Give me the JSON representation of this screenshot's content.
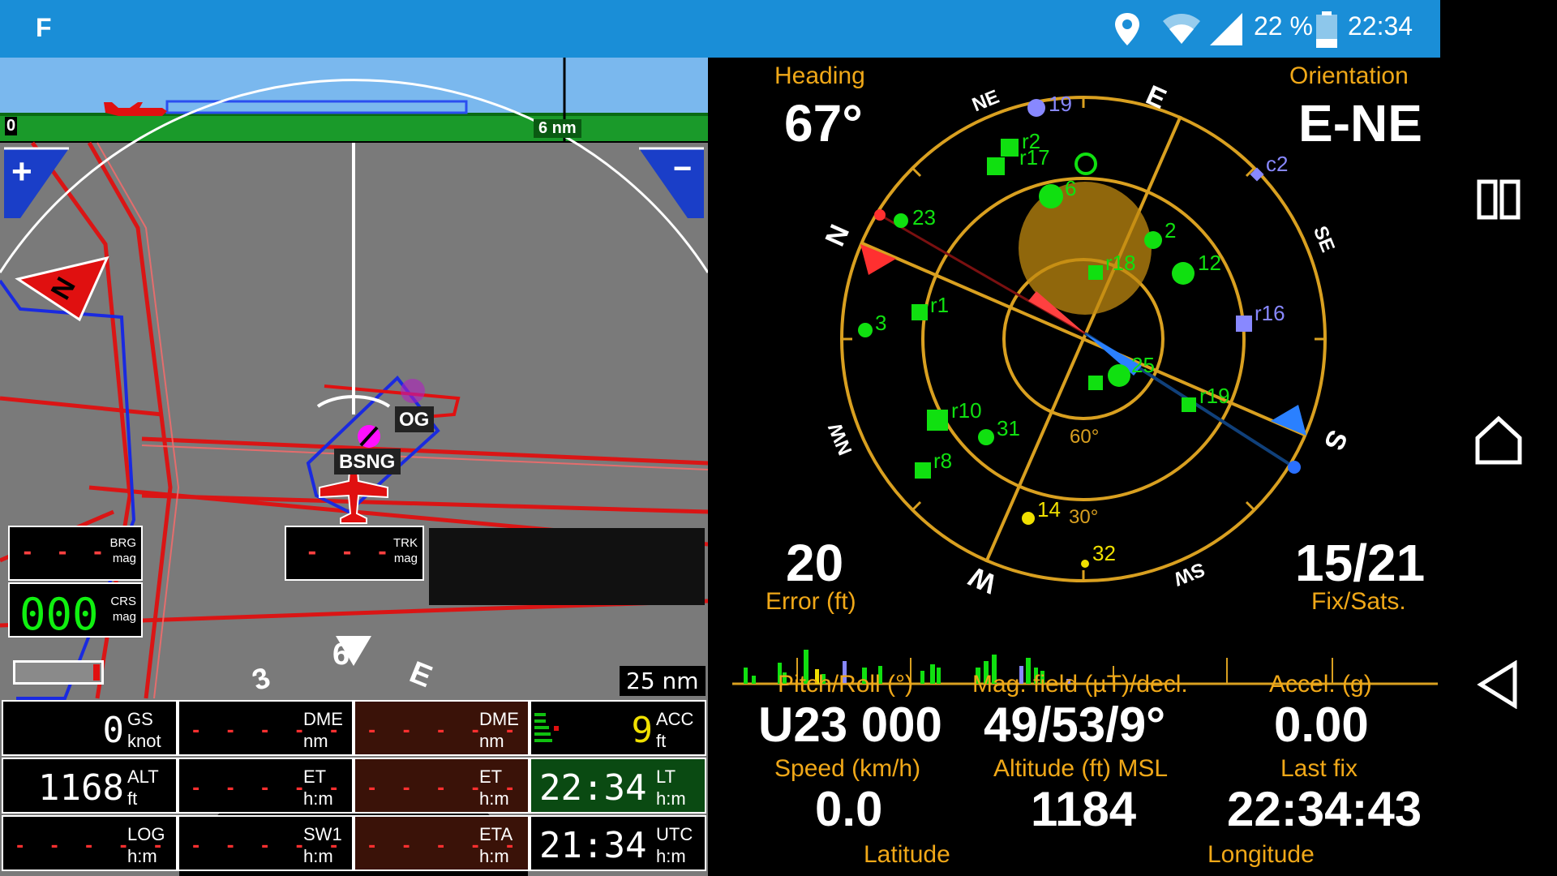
{
  "status_bar": {
    "app_letter": "F",
    "battery_text": "22 %",
    "time": "22:34",
    "icons": [
      "location-icon",
      "wifi-icon",
      "signal-icon",
      "battery-icon"
    ]
  },
  "map": {
    "profile_left_label": "0",
    "profile_scale_label": "6 nm",
    "waypoint_og": "OG",
    "waypoint_bsng": "BSNG",
    "range_label": "25 nm",
    "brg_label": "BRG",
    "brg_unit": "mag",
    "brg_value": "- - -",
    "crs_label": "CRS",
    "crs_unit": "mag",
    "crs_value": "000",
    "trk_label": "TRK",
    "trk_unit": "mag",
    "trk_value": "- - -",
    "compass_labels": [
      "3",
      "6",
      "E"
    ]
  },
  "instruments": {
    "gs": {
      "value": "0",
      "label": "GS",
      "unit": "knot"
    },
    "alt": {
      "value": "1168",
      "label": "ALT",
      "unit": "ft"
    },
    "log": {
      "value": "- - - - -",
      "label": "LOG",
      "unit": "h:m"
    },
    "dme1": {
      "value": "- - - - -",
      "label": "DME",
      "unit": "nm"
    },
    "et1": {
      "value": "- - - - -",
      "label": "ET",
      "unit": "h:m"
    },
    "sw1": {
      "value": "- - - - -",
      "label": "SW1",
      "unit": "h:m"
    },
    "dme2": {
      "value": "- - - - -",
      "label": "DME",
      "unit": "nm"
    },
    "et2": {
      "value": "- - - - -",
      "label": "ET",
      "unit": "h:m"
    },
    "eta": {
      "value": "- - - - -",
      "label": "ETA",
      "unit": "h:m"
    },
    "acc": {
      "value": "9",
      "label": "ACC",
      "unit": "ft"
    },
    "lt": {
      "value": "22:34",
      "label": "LT",
      "unit": "h:m"
    },
    "utc": {
      "value": "21:34",
      "label": "UTC",
      "unit": "h:m"
    }
  },
  "gps": {
    "heading_label": "Heading",
    "heading_value": "67°",
    "orientation_label": "Orientation",
    "orientation_value": "E-NE",
    "error_value": "20",
    "error_label": "Error (ft)",
    "fix_value": "15/21",
    "fix_label": "Fix/Sats.",
    "ring_labels": {
      "r60": "60°",
      "r30": "30°"
    },
    "compass_points": [
      "N",
      "NE",
      "E",
      "SE",
      "S",
      "SW",
      "W",
      "NW"
    ],
    "satellites": [
      {
        "id": "19",
        "color": "#8888ff"
      },
      {
        "id": "r2",
        "color": "#10e010"
      },
      {
        "id": "r17",
        "color": "#10e010"
      },
      {
        "id": "6",
        "color": "#10e010"
      },
      {
        "id": "c2",
        "color": "#8888ff"
      },
      {
        "id": "23",
        "color": "#10e010"
      },
      {
        "id": "2",
        "color": "#10e010"
      },
      {
        "id": "r18",
        "color": "#10e010"
      },
      {
        "id": "12",
        "color": "#10e010"
      },
      {
        "id": "r1",
        "color": "#10e010"
      },
      {
        "id": "r16",
        "color": "#8888ff"
      },
      {
        "id": "3",
        "color": "#10e010"
      },
      {
        "id": "25",
        "color": "#10e010"
      },
      {
        "id": "r10",
        "color": "#10e010"
      },
      {
        "id": "31",
        "color": "#10e010"
      },
      {
        "id": "r19",
        "color": "#10e010"
      },
      {
        "id": "r8",
        "color": "#10e010"
      },
      {
        "id": "14",
        "color": "#f0e000"
      },
      {
        "id": "32",
        "color": "#f0e000"
      }
    ]
  },
  "sensors": {
    "pitch_label": "Pitch/Roll (°)",
    "pitch_value": "U23 000",
    "mag_label": "Mag. field (µT)/decl.",
    "mag_value": "49/53/9°",
    "accel_label": "Accel. (g)",
    "accel_value": "0.00",
    "speed_label": "Speed (km/h)",
    "speed_value": "0.0",
    "altitude_label": "Altitude (ft) MSL",
    "altitude_value": "1184",
    "lastfix_label": "Last fix",
    "lastfix_value": "22:34:43",
    "latitude_label": "Latitude",
    "longitude_label": "Longitude"
  }
}
